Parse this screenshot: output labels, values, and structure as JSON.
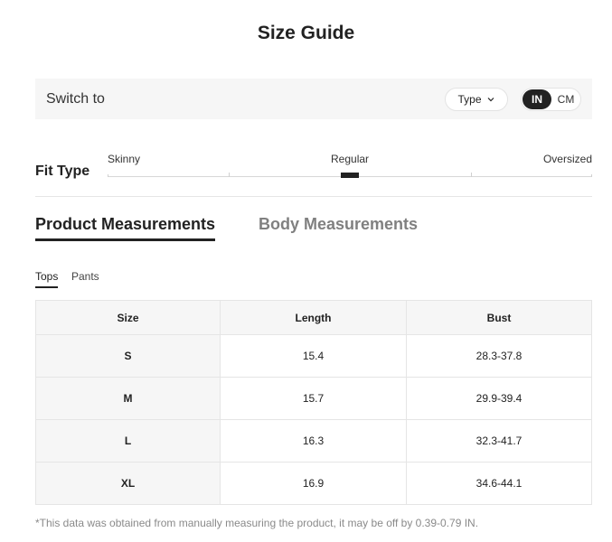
{
  "title": "Size Guide",
  "switch_bar": {
    "label": "Switch to",
    "type_button": {
      "label": "Type",
      "icon": "chevron-down-icon"
    },
    "units": {
      "in_label": "IN",
      "cm_label": "CM",
      "selected": "IN"
    }
  },
  "fit_type": {
    "label": "Fit Type",
    "options": [
      "Skinny",
      "Regular",
      "Oversized"
    ],
    "selected": "Regular"
  },
  "measurement_tabs": {
    "product": "Product Measurements",
    "body": "Body Measurements",
    "active": "Product Measurements"
  },
  "sub_tabs": {
    "tops": "Tops",
    "pants": "Pants",
    "active": "Tops"
  },
  "table": {
    "headers": [
      "Size",
      "Length",
      "Bust"
    ],
    "rows": [
      {
        "size": "S",
        "length": "15.4",
        "bust": "28.3-37.8"
      },
      {
        "size": "M",
        "length": "15.7",
        "bust": "29.9-39.4"
      },
      {
        "size": "L",
        "length": "16.3",
        "bust": "32.3-41.7"
      },
      {
        "size": "XL",
        "length": "16.9",
        "bust": "34.6-44.1"
      }
    ]
  },
  "footnote": "*This data was obtained from manually measuring the product, it may be off by 0.39-0.79 IN.",
  "colors": {
    "accent": "#222222",
    "panel_background": "#f6f6f6",
    "inactive_text": "#808080",
    "footnote_text": "#8a8a8a"
  }
}
